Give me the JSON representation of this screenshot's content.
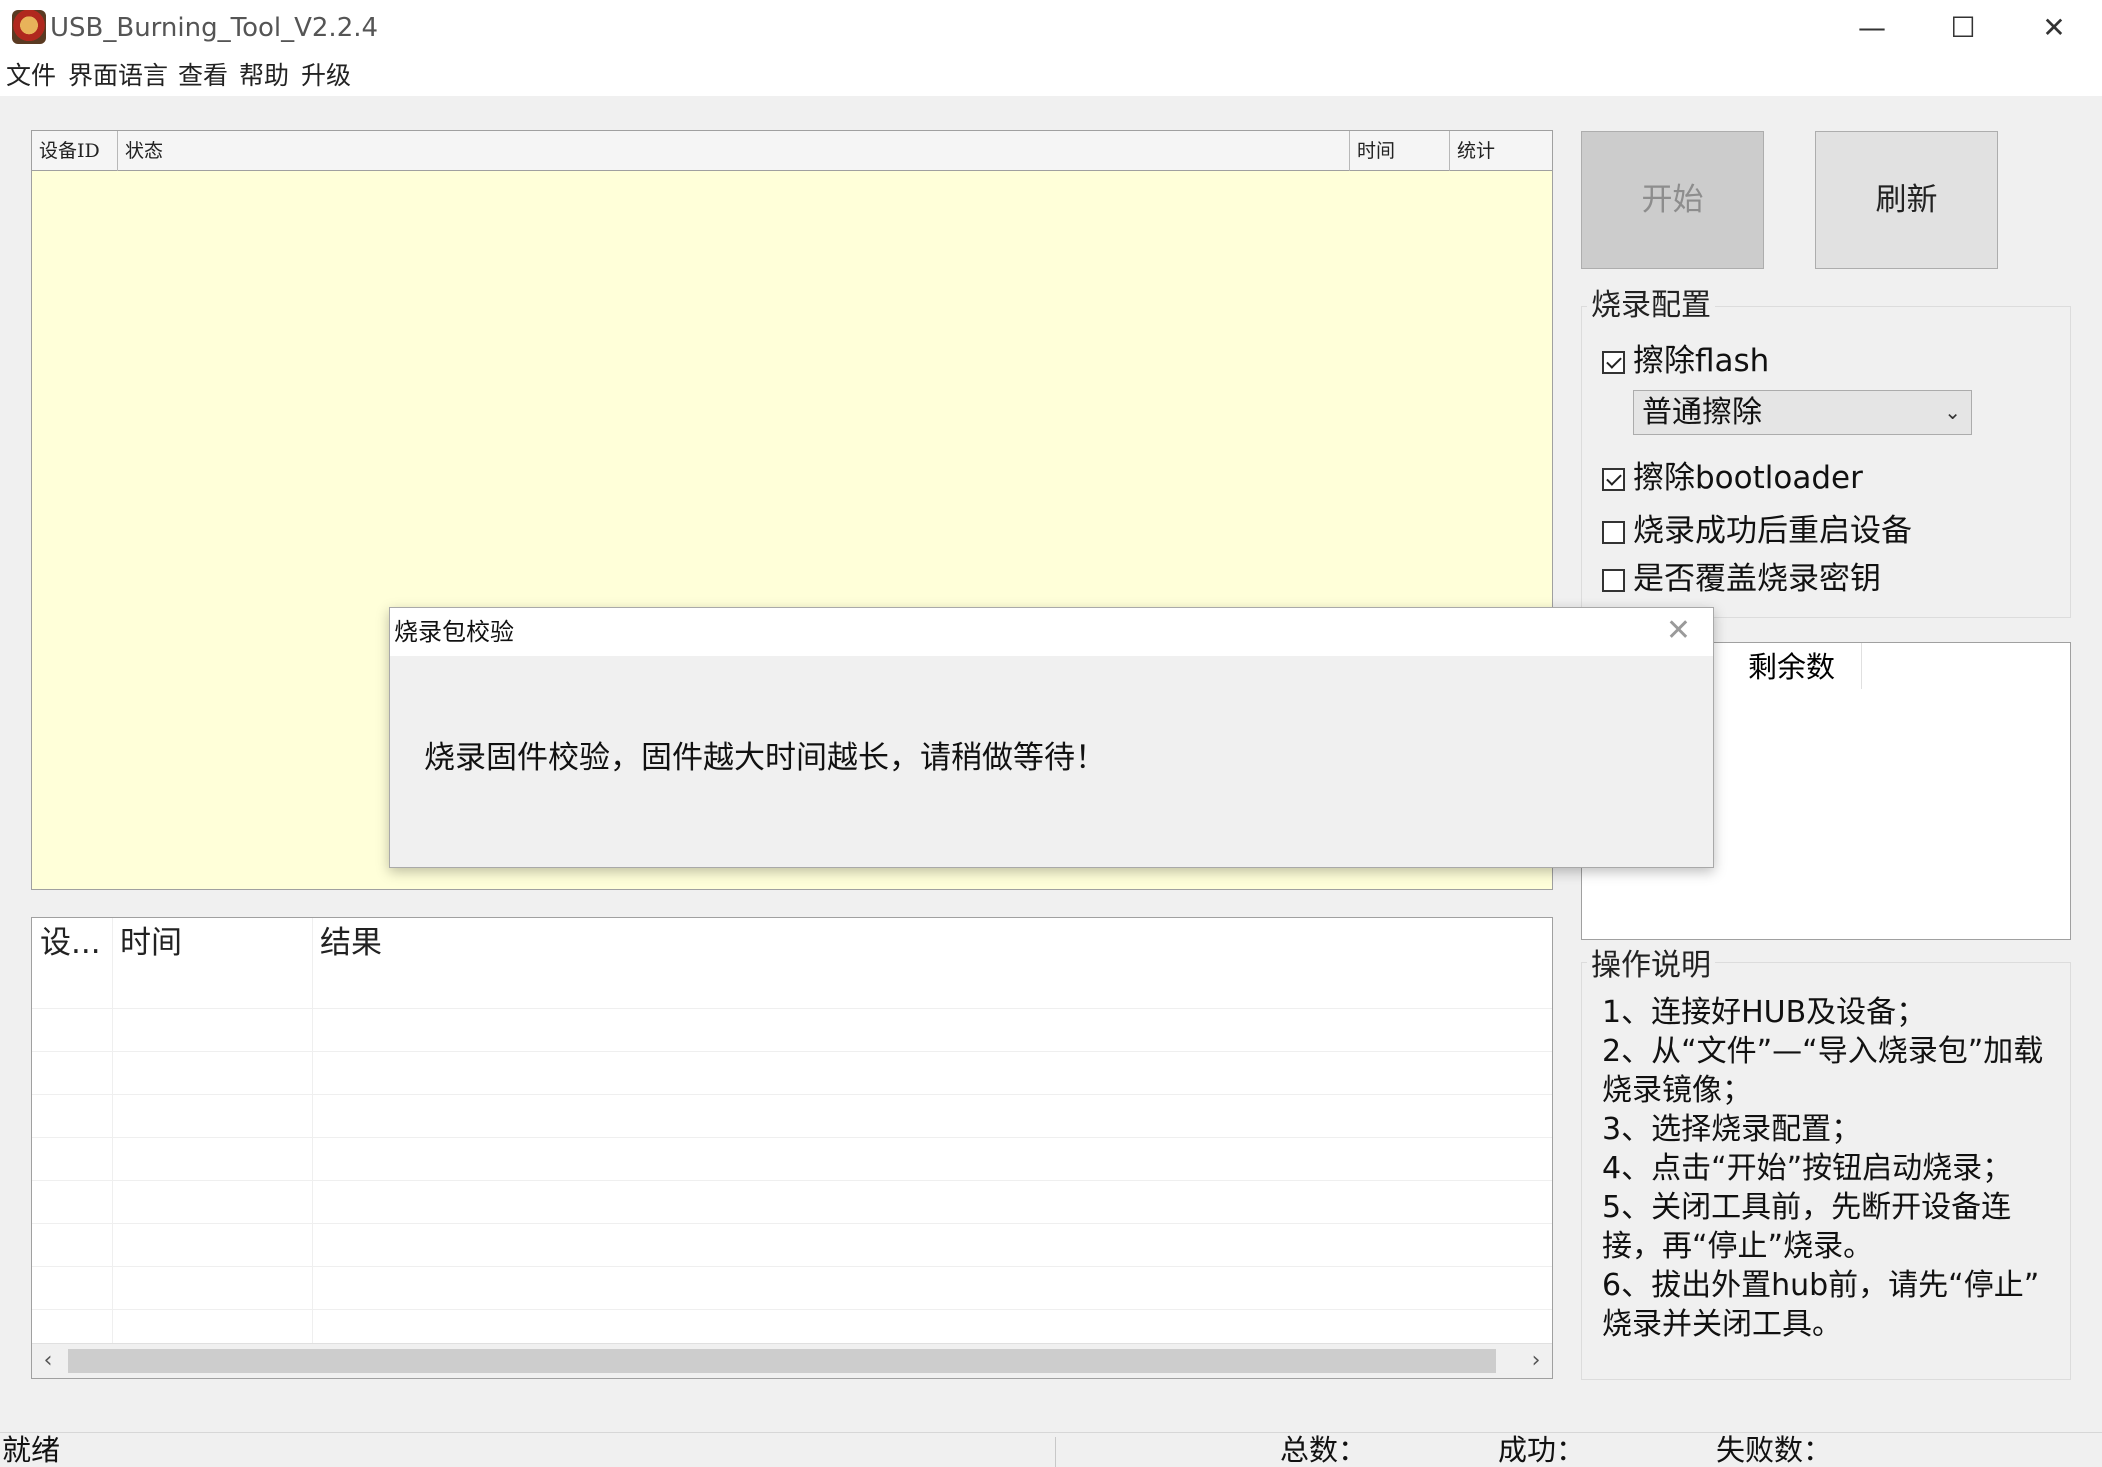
{
  "window": {
    "title": "USB_Burning_Tool_V2.2.4",
    "minimize": "—",
    "maximize": "☐",
    "close": "✕"
  },
  "menu": [
    "文件",
    "界面语言",
    "查看",
    "帮助",
    "升级"
  ],
  "device_table": {
    "columns": [
      "设备ID",
      "状态",
      "时间",
      "统计"
    ]
  },
  "buttons": {
    "start": "开始",
    "refresh": "刷新"
  },
  "config": {
    "title": "烧录配置",
    "erase_flash": {
      "label": "擦除flash",
      "checked": true
    },
    "erase_mode": "普通擦除",
    "erase_bootloader": {
      "label": "擦除bootloader",
      "checked": true
    },
    "reboot_after": {
      "label": "烧录成功后重启设备",
      "checked": false
    },
    "overwrite_key": {
      "label": "是否覆盖烧录密钥",
      "checked": false
    }
  },
  "count_list": {
    "col_truncated": "..",
    "col_remaining": "剩余数"
  },
  "instructions": {
    "title": "操作说明",
    "lines": [
      "1、连接好HUB及设备；",
      "2、从“文件”—“导入烧录包”加载",
      "烧录镜像；",
      "3、选择烧录配置；",
      "4、点击“开始”按钮启动烧录；",
      "5、关闭工具前，先断开设备连",
      "接，再“停止”烧录。",
      "6、拔出外置hub前，请先“停止”",
      "烧录并关闭工具。"
    ]
  },
  "log_table": {
    "columns": [
      "设...",
      "时间",
      "结果"
    ]
  },
  "scroll": {
    "left": "‹",
    "right": "›"
  },
  "status": {
    "ready": "就绪",
    "total": "总数：",
    "success": "成功：",
    "failed": "失败数："
  },
  "dialog": {
    "title": "烧录包校验",
    "close": "✕",
    "message": "烧录固件校验，固件越大时间越长，请稍做等待！"
  }
}
